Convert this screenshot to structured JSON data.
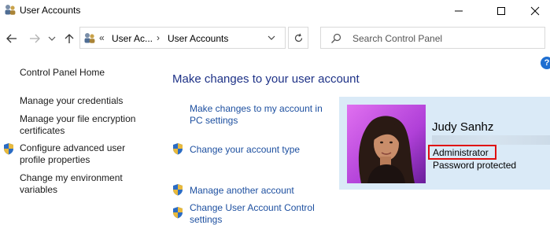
{
  "window": {
    "title": "User Accounts",
    "icon": "users-icon"
  },
  "address": {
    "overflow": "«",
    "crumb1": "User Ac...",
    "separator": "›",
    "crumb2": "User Accounts"
  },
  "search": {
    "placeholder": "Search Control Panel"
  },
  "help": "?",
  "sidebar": {
    "items": [
      {
        "label": "Control Panel Home"
      },
      {
        "label": "Manage your credentials"
      },
      {
        "label": "Manage your file encryption certificates"
      },
      {
        "label": "Configure advanced user profile properties",
        "icon": "shield-icon"
      },
      {
        "label": "Change my environment variables"
      }
    ]
  },
  "main": {
    "title": "Make changes to your user account",
    "tasks": [
      {
        "label": "Make changes to my account in PC settings"
      },
      {
        "label": "Change your account type",
        "icon": "shield-icon"
      },
      {
        "label": "Manage another account",
        "icon": "shield-icon"
      },
      {
        "label": "Change User Account Control settings",
        "icon": "shield-icon"
      }
    ]
  },
  "account": {
    "name": "Judy Sanhz",
    "role": "Administrator",
    "status": "Password protected",
    "highlight_color": "#e01010",
    "panel_color": "#daeaf7"
  }
}
